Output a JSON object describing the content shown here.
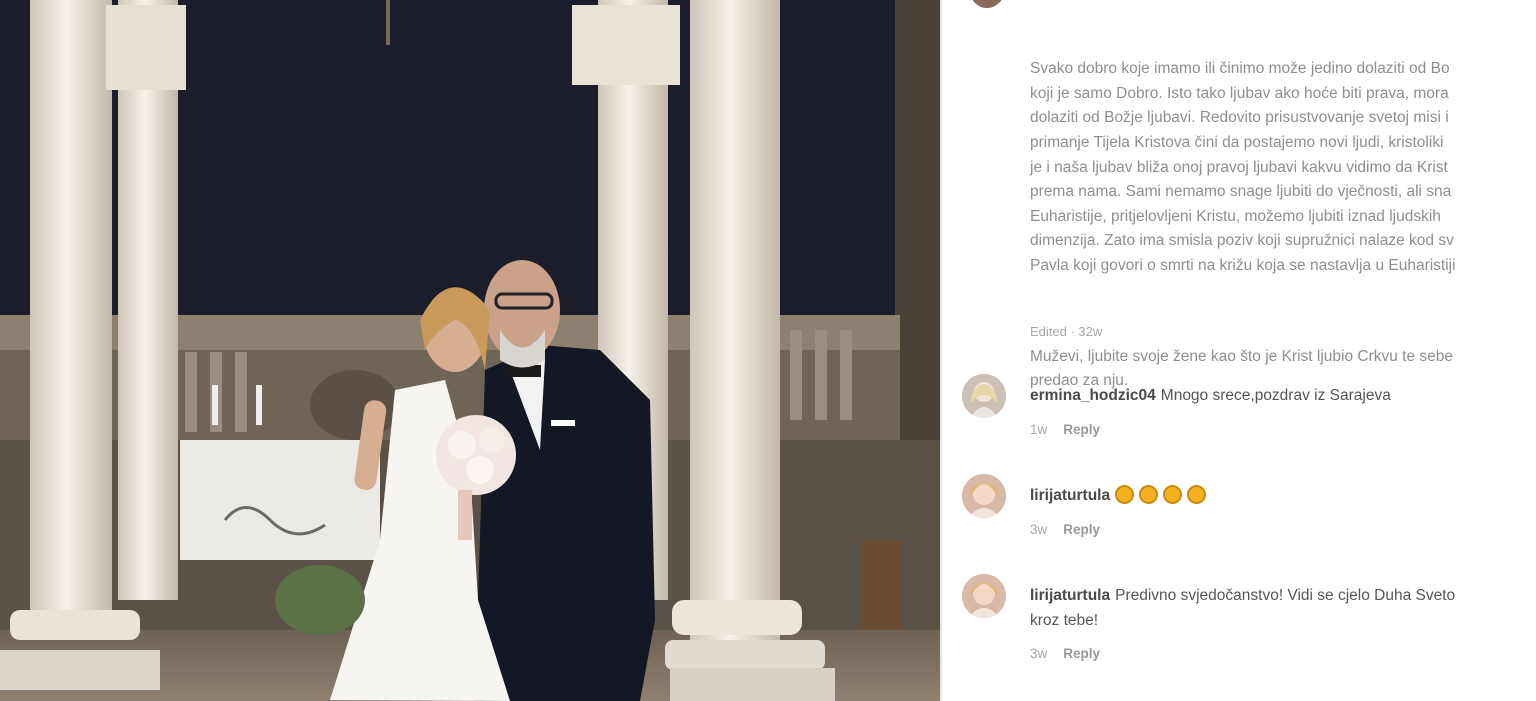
{
  "caption": {
    "lines": [
      "Svako dobro koje imamo ili činimo može jedino dolaziti od Bo",
      "koji je samo Dobro. Isto tako ljubav ako hoće biti prava, mora",
      "dolaziti od Božje ljubavi. Redovito prisustvovanje svetoj misi i",
      "primanje Tijela Kristova čini da postajemo novi ljudi, kristoliki",
      "je i naša ljubav bliža onoj pravoj ljubavi kakvu vidimo da Krist",
      "prema nama. Sami nemamo snage ljubiti do vječnosti, ali sna",
      "Euharistije, pritjelovljeni Kristu, možemo ljubiti iznad ljudskih",
      "dimenzija. Zato ima smisla poziv koji supružnici nalaze kod sv",
      "Pavla koji govori o smrti na križu koja se nastavlja u Euharistiji"
    ],
    "quote_lines": [
      "Muževi, ljubite svoje žene kao što je Krist ljubio Crkvu te sebe",
      "predao za nju."
    ],
    "edited": "Edited · 32w"
  },
  "comments": [
    {
      "username": "ermina_hodzic04",
      "text": "Mnogo srece,pozdrav iz Sarajeva",
      "time": "1w",
      "reply": "Reply",
      "avatar_color": "#cbbfb6"
    },
    {
      "username": "lirijaturtula",
      "text": "",
      "emoji_count": 4,
      "emoji_icon": "clapping-hands-icon",
      "time": "3w",
      "reply": "Reply",
      "avatar_color": "#d8b9a8"
    },
    {
      "username": "lirijaturtula",
      "text": "Predivno svjedočanstvo! Vidi se cjelo Duha Sveto",
      "text_line2": "kroz tebe!",
      "time": "3w",
      "reply": "Reply",
      "avatar_color": "#d8b9a8"
    }
  ],
  "colors": {
    "night_sky": "#1c1d2a",
    "column": "#efe9e1",
    "text_muted": "#8e8e8e",
    "username": "#4a4a4a",
    "emoji": "#f2b01e"
  }
}
